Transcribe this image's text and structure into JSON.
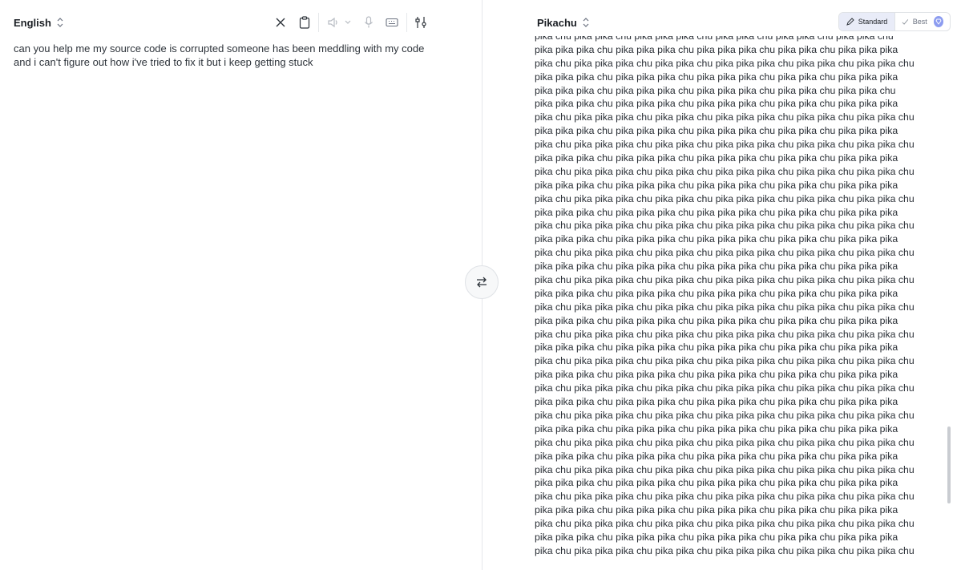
{
  "source": {
    "language": "English",
    "text": "can you help me my source code is corrupted someone has been meddling with my code and i can't figure out how i've tried to fix it but i keep getting stuck"
  },
  "toolbar_icons": [
    "clear-icon",
    "clipboard-icon",
    "speaker-icon",
    "microphone-icon",
    "keyboard-icon",
    "sliders-icon"
  ],
  "target": {
    "language": "Pikachu",
    "lines": [
      "pika chu pika pika chu pika pika pika chu pika pika chu pika pika chu pika pika chu",
      "pika pika pika chu pika pika pika chu pika pika pika chu pika pika chu pika pika pika",
      "pika chu pika pika pika chu pika pika chu pika pika pika chu pika pika chu pika pika chu",
      "pika pika pika chu pika pika pika chu pika pika pika chu pika pika chu pika pika pika",
      "pika pika pika chu pika pika pika chu pika pika pika chu pika pika chu pika pika chu",
      "pika pika pika chu pika pika pika chu pika pika pika chu pika pika chu pika pika pika",
      "pika chu pika pika pika chu pika pika chu pika pika pika chu pika pika chu pika pika chu",
      "pika pika pika chu pika pika pika chu pika pika pika chu pika pika chu pika pika pika",
      "pika chu pika pika pika chu pika pika chu pika pika pika chu pika pika chu pika pika chu",
      "pika pika pika chu pika pika pika chu pika pika pika chu pika pika chu pika pika pika",
      "pika chu pika pika pika chu pika pika chu pika pika pika chu pika pika chu pika pika chu",
      "pika pika pika chu pika pika pika chu pika pika pika chu pika pika chu pika pika pika",
      "pika chu pika pika pika chu pika pika chu pika pika pika chu pika pika chu pika pika chu",
      "pika pika pika chu pika pika pika chu pika pika pika chu pika pika chu pika pika pika",
      "pika chu pika pika pika chu pika pika chu pika pika pika chu pika pika chu pika pika chu",
      "pika pika pika chu pika pika pika chu pika pika pika chu pika pika chu pika pika pika",
      "pika chu pika pika pika chu pika pika chu pika pika pika chu pika pika chu pika pika chu",
      "pika pika pika chu pika pika pika chu pika pika pika chu pika pika chu pika pika pika",
      "pika chu pika pika pika chu pika pika chu pika pika pika chu pika pika chu pika pika chu",
      "pika pika pika chu pika pika pika chu pika pika pika chu pika pika chu pika pika pika",
      "pika chu pika pika pika chu pika pika chu pika pika pika chu pika pika chu pika pika chu",
      "pika pika pika chu pika pika pika chu pika pika pika chu pika pika chu pika pika pika",
      "pika chu pika pika pika chu pika pika chu pika pika pika chu pika pika chu pika pika chu",
      "pika pika pika chu pika pika pika chu pika pika pika chu pika pika chu pika pika pika",
      "pika chu pika pika pika chu pika pika chu pika pika pika chu pika pika chu pika pika chu",
      "pika pika pika chu pika pika pika chu pika pika pika chu pika pika chu pika pika pika",
      "pika chu pika pika pika chu pika pika chu pika pika pika chu pika pika chu pika pika chu",
      "pika pika pika chu pika pika pika chu pika pika pika chu pika pika chu pika pika pika",
      "pika chu pika pika pika chu pika pika chu pika pika pika chu pika pika chu pika pika chu",
      "pika pika pika chu pika pika pika chu pika pika pika chu pika pika chu pika pika pika",
      "pika chu pika pika pika chu pika pika chu pika pika pika chu pika pika chu pika pika chu",
      "pika pika pika chu pika pika pika chu pika pika pika chu pika pika chu pika pika pika",
      "pika chu pika pika pika chu pika pika chu pika pika pika chu pika pika chu pika pika chu",
      "pika pika pika chu pika pika pika chu pika pika pika chu pika pika chu pika pika pika",
      "pika chu pika pika pika chu pika pika chu pika pika pika chu pika pika chu pika pika chu",
      "pika pika pika chu pika pika pika chu pika pika pika chu pika pika chu pika pika pika",
      "pika chu pika pika pika chu pika pika chu pika pika pika chu pika pika chu pika pika chu",
      "pika pika pika chu pika pika pika chu pika pika pika chu pika pika chu pika pika pika",
      "pika chu pika pika pika chu pika pika chu pika pika pika chu pika pika chu pika pika chu",
      "pika chu pika pika chu pika pika pika chu pika pika chu pika pika chu pika pika chu"
    ]
  },
  "modes": {
    "standard": "Standard",
    "best": "Best"
  },
  "colors": {
    "accent": "#8c9cf0",
    "active_mode_bg": "#e9ecf8"
  }
}
